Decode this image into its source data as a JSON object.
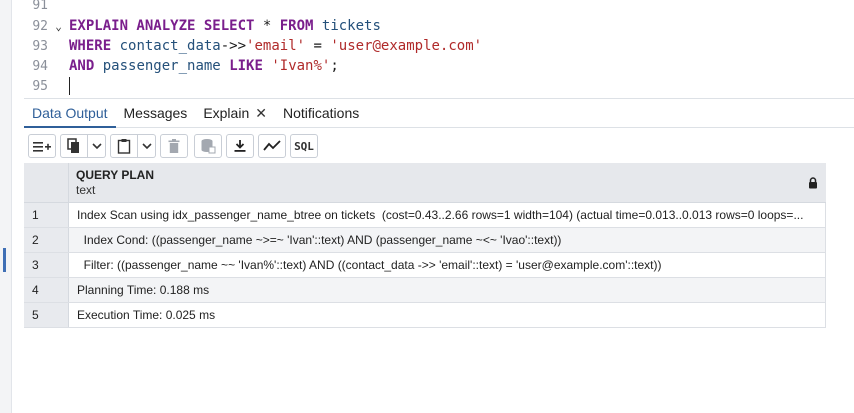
{
  "editor": {
    "lines": [
      {
        "number": "91",
        "fold": "",
        "tokens": []
      },
      {
        "number": "92",
        "fold": "⌄",
        "tokens": [
          {
            "t": "kw",
            "v": "EXPLAIN ANALYZE SELECT"
          },
          {
            "t": "code",
            "v": " * "
          },
          {
            "t": "kw",
            "v": "FROM"
          },
          {
            "t": "code",
            "v": " "
          },
          {
            "t": "id",
            "v": "tickets"
          }
        ]
      },
      {
        "number": "93",
        "fold": "",
        "tokens": [
          {
            "t": "kw",
            "v": "WHERE"
          },
          {
            "t": "code",
            "v": " "
          },
          {
            "t": "id",
            "v": "contact_data"
          },
          {
            "t": "code",
            "v": "->>"
          },
          {
            "t": "str",
            "v": "'email'"
          },
          {
            "t": "code",
            "v": " = "
          },
          {
            "t": "str",
            "v": "'user@example.com'"
          }
        ]
      },
      {
        "number": "94",
        "fold": "",
        "tokens": [
          {
            "t": "kw",
            "v": "AND"
          },
          {
            "t": "code",
            "v": " "
          },
          {
            "t": "id",
            "v": "passenger_name"
          },
          {
            "t": "code",
            "v": " "
          },
          {
            "t": "kw",
            "v": "LIKE"
          },
          {
            "t": "code",
            "v": " "
          },
          {
            "t": "str",
            "v": "'Ivan%'"
          },
          {
            "t": "code",
            "v": ";"
          }
        ]
      },
      {
        "number": "95",
        "fold": "",
        "tokens": [],
        "caret": true
      }
    ]
  },
  "tabs": [
    {
      "label": "Data Output",
      "active": true,
      "closable": false
    },
    {
      "label": "Messages",
      "active": false,
      "closable": false
    },
    {
      "label": "Explain",
      "active": false,
      "closable": true
    },
    {
      "label": "Notifications",
      "active": false,
      "closable": false
    }
  ],
  "tab_close_glyph": "✕",
  "toolbar": {
    "sql_label": "SQL"
  },
  "grid": {
    "column": {
      "name": "QUERY PLAN",
      "type": "text"
    },
    "rows": [
      {
        "num": "1",
        "value": "Index Scan using idx_passenger_name_btree on tickets  (cost=0.43..2.66 rows=1 width=104) (actual time=0.013..0.013 rows=0 loops=..."
      },
      {
        "num": "2",
        "value": "  Index Cond: ((passenger_name ~>=~ 'Ivan'::text) AND (passenger_name ~<~ 'Ivao'::text))"
      },
      {
        "num": "3",
        "value": "  Filter: ((passenger_name ~~ 'Ivan%'::text) AND ((contact_data ->> 'email'::text) = 'user@example.com'::text))"
      },
      {
        "num": "4",
        "value": "Planning Time: 0.188 ms"
      },
      {
        "num": "5",
        "value": "Execution Time: 0.025 ms"
      }
    ]
  },
  "colors": {
    "accent": "#2f5f99",
    "keyword": "#7a1e8c",
    "string": "#b02a2a",
    "identifier": "#24507a"
  }
}
